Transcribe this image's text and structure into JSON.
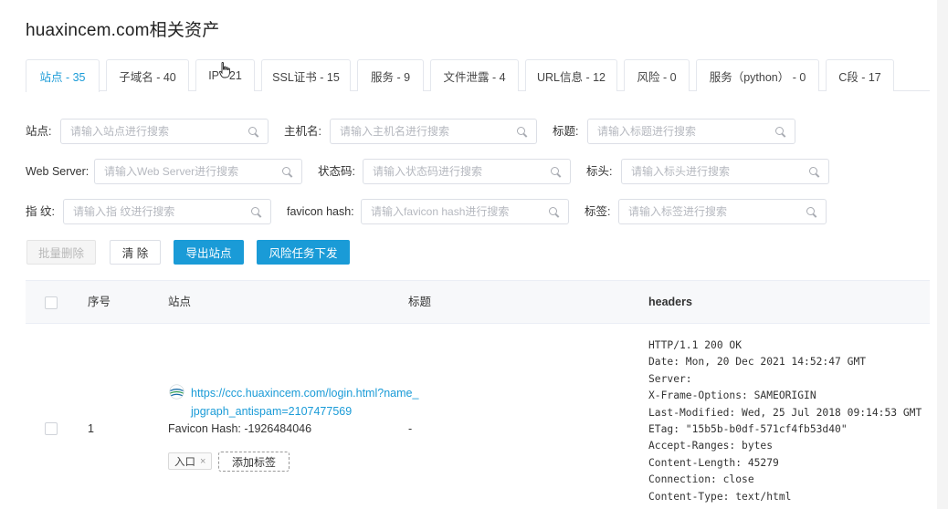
{
  "page": {
    "title": "huaxincem.com相关资产"
  },
  "tabs": [
    {
      "label": "站点 - 35",
      "active": true
    },
    {
      "label": "子域名 - 40",
      "active": false
    },
    {
      "label": "IP - 21",
      "active": false
    },
    {
      "label": "SSL证书 - 15",
      "active": false
    },
    {
      "label": "服务 - 9",
      "active": false
    },
    {
      "label": "文件泄露 - 4",
      "active": false
    },
    {
      "label": "URL信息 - 12",
      "active": false
    },
    {
      "label": "风险 - 0",
      "active": false
    },
    {
      "label": "服务（python） - 0",
      "active": false
    },
    {
      "label": "C段 - 17",
      "active": false
    }
  ],
  "filters": [
    {
      "label": "站点:",
      "placeholder": "请输入站点进行搜索"
    },
    {
      "label": "主机名:",
      "placeholder": "请输入主机名进行搜索"
    },
    {
      "label": "标题:",
      "placeholder": "请输入标题进行搜索"
    },
    {
      "label": "Web Server:",
      "placeholder": "请输入Web Server进行搜索"
    },
    {
      "label": "状态码:",
      "placeholder": "请输入状态码进行搜索"
    },
    {
      "label": "标头:",
      "placeholder": "请输入标头进行搜索"
    },
    {
      "label": "指 纹:",
      "placeholder": "请输入指 纹进行搜索"
    },
    {
      "label": "favicon hash:",
      "placeholder": "请输入favicon hash进行搜索"
    },
    {
      "label": "标签:",
      "placeholder": "请输入标签进行搜索"
    }
  ],
  "actions": {
    "batch_delete": "批量删除",
    "clear": "清 除",
    "export_sites": "导出站点",
    "dispatch_risk_task": "风险任务下发"
  },
  "table": {
    "columns": {
      "index": "序号",
      "site": "站点",
      "title": "标题",
      "headers": "headers"
    },
    "rows": [
      {
        "index": "1",
        "url": "https://ccc.huaxincem.com/login.html?name_jpgraph_antispam=2107477569",
        "favicon_hash": "Favicon Hash: -1926484046",
        "title": "-",
        "tag": "入口",
        "add_tag_label": "添加标签",
        "headers": "HTTP/1.1 200 OK\nDate: Mon, 20 Dec 2021 14:52:47 GMT\nServer:\nX-Frame-Options: SAMEORIGIN\nLast-Modified: Wed, 25 Jul 2018 09:14:53 GMT\nETag: \"15b5b-b0df-571cf4fb53d40\"\nAccept-Ranges: bytes\nContent-Length: 45279\nConnection: close\nContent-Type: text/html"
      }
    ]
  }
}
